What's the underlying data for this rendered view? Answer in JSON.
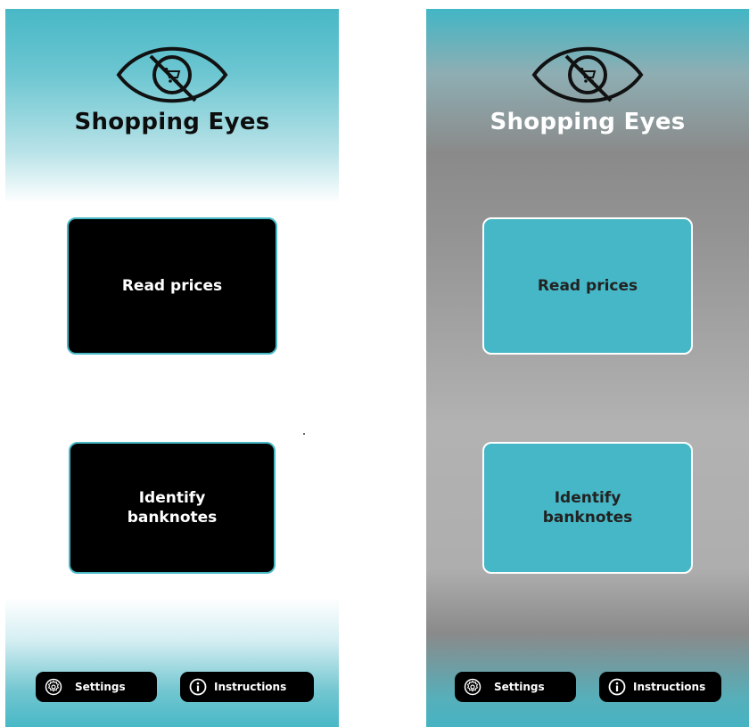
{
  "screens": [
    {
      "variant": "light-theme",
      "app_title": "Shopping Eyes",
      "logo_icon": "eye-with-cart-icon",
      "buttons": {
        "read_prices": "Read prices",
        "identify_banknotes": "Identify banknotes"
      },
      "footer": {
        "settings_label": "Settings",
        "settings_icon": "gear-icon",
        "instructions_label": "Instructions",
        "instructions_icon": "info-icon"
      },
      "colors": {
        "accent": "#47b8c6",
        "button_bg": "#000000",
        "button_text": "#ffffff",
        "title": "#0d0d0d"
      }
    },
    {
      "variant": "dark-theme",
      "app_title": "Shopping Eyes",
      "logo_icon": "eye-with-cart-icon",
      "buttons": {
        "read_prices": "Read prices",
        "identify_banknotes": "Identify banknotes"
      },
      "footer": {
        "settings_label": "Settings",
        "settings_icon": "gear-icon",
        "instructions_label": "Instructions",
        "instructions_icon": "info-icon"
      },
      "colors": {
        "accent": "#45b7c6",
        "button_bg": "#45b7c6",
        "button_text": "#222222",
        "title": "#ffffff"
      }
    }
  ]
}
